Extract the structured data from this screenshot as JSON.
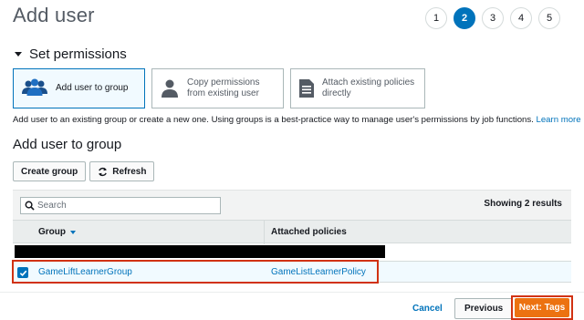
{
  "page": {
    "title": "Add user"
  },
  "steps": [
    "1",
    "2",
    "3",
    "4",
    "5"
  ],
  "active_step": "2",
  "permissions": {
    "section_label": "Set permissions",
    "options": [
      {
        "label": "Add user to group",
        "icon": "users-group-icon",
        "selected": true
      },
      {
        "label": "Copy permissions from existing user",
        "icon": "user-icon",
        "selected": false
      },
      {
        "label": "Attach existing policies directly",
        "icon": "document-icon",
        "selected": false
      }
    ],
    "helper_text": "Add user to an existing group or create a new one. Using groups is a best-practice way to manage user's permissions by job functions.",
    "learn_more": "Learn more"
  },
  "groups": {
    "title": "Add user to group",
    "create_button": "Create group",
    "refresh_button": "Refresh",
    "search_placeholder": "Search",
    "results_text": "Showing 2 results",
    "columns": {
      "group": "Group",
      "policies": "Attached policies"
    },
    "rows": [
      {
        "group": "GameLiftLearnerGroup",
        "policies": "GameListLearnerPolicy",
        "checked": true
      }
    ]
  },
  "footer": {
    "cancel": "Cancel",
    "previous": "Previous",
    "next": "Next: Tags"
  },
  "colors": {
    "accent": "#0073bb",
    "primary_button": "#ec7211",
    "highlight": "#d13212"
  }
}
